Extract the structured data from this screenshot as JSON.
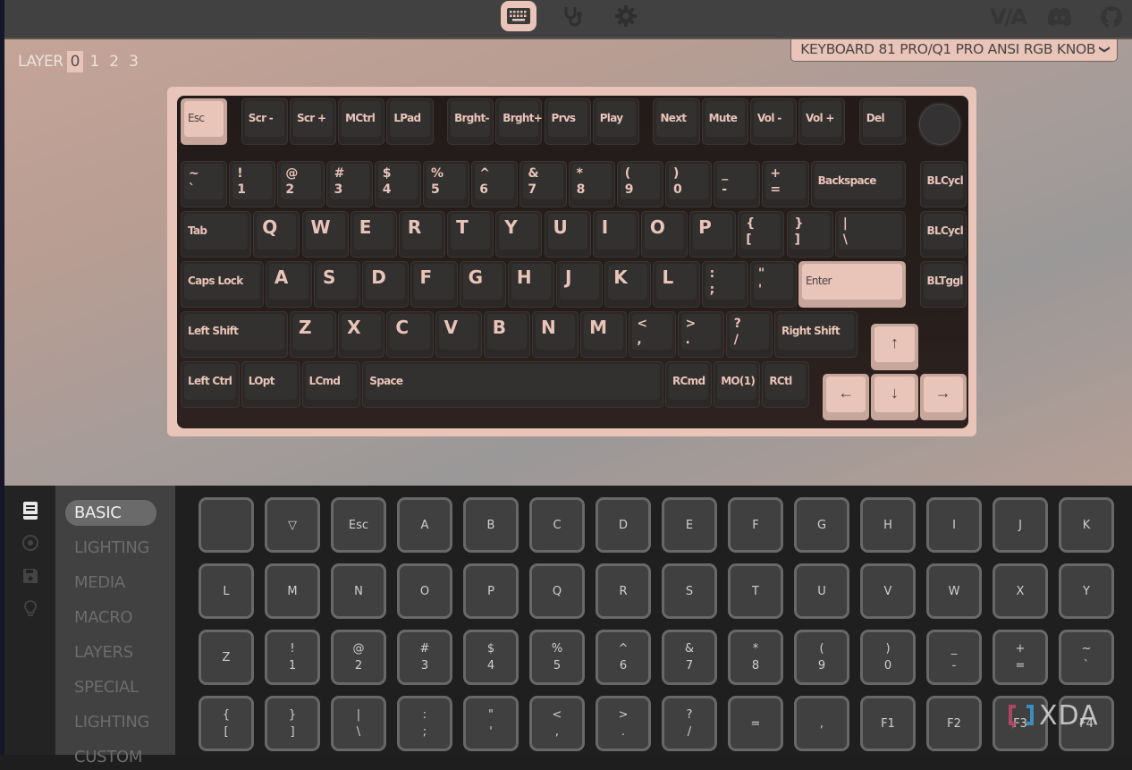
{
  "topbar": {
    "nav": [
      {
        "name": "configure",
        "icon": "keyboard-icon",
        "active": true
      },
      {
        "name": "test",
        "icon": "stethoscope-icon",
        "active": false
      },
      {
        "name": "settings",
        "icon": "gear-icon",
        "active": false
      }
    ],
    "external": [
      {
        "label": "VIA",
        "icon": "via-logo-icon"
      },
      {
        "label": "",
        "icon": "discord-icon"
      },
      {
        "label": "",
        "icon": "github-icon"
      }
    ],
    "via_label": "V/A"
  },
  "layers": {
    "label": "LAYER",
    "items": [
      "0",
      "1",
      "2",
      "3"
    ],
    "active": "0"
  },
  "keyboard_select": {
    "value": "KEYBOARD 81 PRO/Q1 PRO ANSI RGB KNOB",
    "chevron": "❯"
  },
  "keyboard": {
    "rows": [
      [
        {
          "l": "Esc",
          "x": 0,
          "w": 1,
          "accent": true
        },
        {
          "l": "Scr -",
          "x": 1.25,
          "w": 1
        },
        {
          "l": "Scr +",
          "x": 2.25,
          "w": 1
        },
        {
          "l": "MCtrl",
          "x": 3.25,
          "w": 1
        },
        {
          "l": "LPad",
          "x": 4.25,
          "w": 1
        },
        {
          "l": "Brght-",
          "x": 5.5,
          "w": 1
        },
        {
          "l": "Brght+",
          "x": 6.5,
          "w": 1
        },
        {
          "l": "Prvs",
          "x": 7.5,
          "w": 1
        },
        {
          "l": "Play",
          "x": 8.5,
          "w": 1
        },
        {
          "l": "Next",
          "x": 9.75,
          "w": 1
        },
        {
          "l": "Mute",
          "x": 10.75,
          "w": 1
        },
        {
          "l": "Vol -",
          "x": 11.75,
          "w": 1
        },
        {
          "l": "Vol +",
          "x": 12.75,
          "w": 1
        },
        {
          "l": "Del",
          "x": 14,
          "w": 1
        }
      ],
      [
        {
          "top": "~",
          "bot": "`",
          "x": 0,
          "w": 1
        },
        {
          "top": "!",
          "bot": "1",
          "x": 1,
          "w": 1
        },
        {
          "top": "@",
          "bot": "2",
          "x": 2,
          "w": 1
        },
        {
          "top": "#",
          "bot": "3",
          "x": 3,
          "w": 1
        },
        {
          "top": "$",
          "bot": "4",
          "x": 4,
          "w": 1
        },
        {
          "top": "%",
          "bot": "5",
          "x": 5,
          "w": 1
        },
        {
          "top": "^",
          "bot": "6",
          "x": 6,
          "w": 1
        },
        {
          "top": "&",
          "bot": "7",
          "x": 7,
          "w": 1
        },
        {
          "top": "*",
          "bot": "8",
          "x": 8,
          "w": 1
        },
        {
          "top": "(",
          "bot": "9",
          "x": 9,
          "w": 1
        },
        {
          "top": ")",
          "bot": "0",
          "x": 10,
          "w": 1
        },
        {
          "top": "_",
          "bot": "-",
          "x": 11,
          "w": 1
        },
        {
          "top": "+",
          "bot": "=",
          "x": 12,
          "w": 1
        },
        {
          "l": "Backspace",
          "x": 13,
          "w": 2
        },
        {
          "l": "BLCycl",
          "x": 15.25,
          "w": 1
        }
      ],
      [
        {
          "l": "Tab",
          "x": 0,
          "w": 1.5
        },
        {
          "big": "Q",
          "x": 1.5,
          "w": 1
        },
        {
          "big": "W",
          "x": 2.5,
          "w": 1
        },
        {
          "big": "E",
          "x": 3.5,
          "w": 1
        },
        {
          "big": "R",
          "x": 4.5,
          "w": 1
        },
        {
          "big": "T",
          "x": 5.5,
          "w": 1
        },
        {
          "big": "Y",
          "x": 6.5,
          "w": 1
        },
        {
          "big": "U",
          "x": 7.5,
          "w": 1
        },
        {
          "big": "I",
          "x": 8.5,
          "w": 1
        },
        {
          "big": "O",
          "x": 9.5,
          "w": 1
        },
        {
          "big": "P",
          "x": 10.5,
          "w": 1
        },
        {
          "top": "{",
          "bot": "[",
          "x": 11.5,
          "w": 1
        },
        {
          "top": "}",
          "bot": "]",
          "x": 12.5,
          "w": 1
        },
        {
          "top": "|",
          "bot": "\\",
          "x": 13.5,
          "w": 1.5
        },
        {
          "l": "BLCycl",
          "x": 15.25,
          "w": 1
        }
      ],
      [
        {
          "l": "Caps Lock",
          "x": 0,
          "w": 1.75
        },
        {
          "big": "A",
          "x": 1.75,
          "w": 1
        },
        {
          "big": "S",
          "x": 2.75,
          "w": 1
        },
        {
          "big": "D",
          "x": 3.75,
          "w": 1
        },
        {
          "big": "F",
          "x": 4.75,
          "w": 1
        },
        {
          "big": "G",
          "x": 5.75,
          "w": 1
        },
        {
          "big": "H",
          "x": 6.75,
          "w": 1
        },
        {
          "big": "J",
          "x": 7.75,
          "w": 1
        },
        {
          "big": "K",
          "x": 8.75,
          "w": 1
        },
        {
          "big": "L",
          "x": 9.75,
          "w": 1
        },
        {
          "top": ":",
          "bot": ";",
          "x": 10.75,
          "w": 1
        },
        {
          "top": "\"",
          "bot": "'",
          "x": 11.75,
          "w": 1
        },
        {
          "l": "Enter",
          "x": 12.75,
          "w": 2.25,
          "accent": true
        },
        {
          "l": "BLTggl",
          "x": 15.25,
          "w": 1
        }
      ],
      [
        {
          "l": "Left Shift",
          "x": 0,
          "w": 2.25
        },
        {
          "big": "Z",
          "x": 2.25,
          "w": 1
        },
        {
          "big": "X",
          "x": 3.25,
          "w": 1
        },
        {
          "big": "C",
          "x": 4.25,
          "w": 1
        },
        {
          "big": "V",
          "x": 5.25,
          "w": 1
        },
        {
          "big": "B",
          "x": 6.25,
          "w": 1
        },
        {
          "big": "N",
          "x": 7.25,
          "w": 1
        },
        {
          "big": "M",
          "x": 8.25,
          "w": 1
        },
        {
          "top": "<",
          "bot": ",",
          "x": 9.25,
          "w": 1
        },
        {
          "top": ">",
          "bot": ".",
          "x": 10.25,
          "w": 1
        },
        {
          "top": "?",
          "bot": "/",
          "x": 11.25,
          "w": 1
        },
        {
          "l": "Right Shift",
          "x": 12.25,
          "w": 1.75
        },
        {
          "arrow": "↑",
          "x": 14.25,
          "w": 1,
          "accent": true,
          "dy": 0.25
        }
      ],
      [
        {
          "l": "Left Ctrl",
          "x": 0,
          "w": 1.25
        },
        {
          "l": "LOpt",
          "x": 1.25,
          "w": 1.25
        },
        {
          "l": "LCmd",
          "x": 2.5,
          "w": 1.25
        },
        {
          "l": "Space",
          "x": 3.75,
          "w": 6.25
        },
        {
          "l": "RCmd",
          "x": 10,
          "w": 1
        },
        {
          "l": "MO(1)",
          "x": 11,
          "w": 1
        },
        {
          "l": "RCtl",
          "x": 12,
          "w": 1
        },
        {
          "arrow": "←",
          "x": 13.25,
          "w": 1,
          "accent": true,
          "dy": 0.25
        },
        {
          "arrow": "↓",
          "x": 14.25,
          "w": 1,
          "accent": true,
          "dy": 0.25
        },
        {
          "arrow": "→",
          "x": 15.25,
          "w": 1,
          "accent": true,
          "dy": 0.25
        }
      ]
    ]
  },
  "sidebar_icons": [
    {
      "name": "keycode-book-icon",
      "active": true
    },
    {
      "name": "target-icon",
      "active": false
    },
    {
      "name": "save-icon",
      "active": false
    },
    {
      "name": "lightbulb-icon",
      "active": false
    }
  ],
  "menu": {
    "items": [
      "BASIC",
      "LIGHTING",
      "MEDIA",
      "MACRO",
      "LAYERS",
      "SPECIAL",
      "LIGHTING",
      "CUSTOM"
    ],
    "active": "BASIC"
  },
  "keycodes": [
    [
      [
        ""
      ],
      [
        "▽"
      ],
      [
        "Esc"
      ],
      [
        "A"
      ],
      [
        "B"
      ],
      [
        "C"
      ],
      [
        "D"
      ],
      [
        "E"
      ],
      [
        "F"
      ],
      [
        "G"
      ],
      [
        "H"
      ],
      [
        "I"
      ],
      [
        "J"
      ],
      [
        "K"
      ]
    ],
    [
      [
        "L"
      ],
      [
        "M"
      ],
      [
        "N"
      ],
      [
        "O"
      ],
      [
        "P"
      ],
      [
        "Q"
      ],
      [
        "R"
      ],
      [
        "S"
      ],
      [
        "T"
      ],
      [
        "U"
      ],
      [
        "V"
      ],
      [
        "W"
      ],
      [
        "X"
      ],
      [
        "Y"
      ]
    ],
    [
      [
        "Z"
      ],
      [
        "!",
        "1"
      ],
      [
        "@",
        "2"
      ],
      [
        "#",
        "3"
      ],
      [
        "$",
        "4"
      ],
      [
        "%",
        "5"
      ],
      [
        "^",
        "6"
      ],
      [
        "&",
        "7"
      ],
      [
        "*",
        "8"
      ],
      [
        "(",
        "9"
      ],
      [
        ")",
        "0"
      ],
      [
        "_",
        "-"
      ],
      [
        "+",
        "="
      ],
      [
        "~",
        "`"
      ]
    ],
    [
      [
        "{",
        "["
      ],
      [
        "}",
        "]"
      ],
      [
        "|",
        "\\"
      ],
      [
        ":",
        ";"
      ],
      [
        "\"",
        "'"
      ],
      [
        "<",
        ","
      ],
      [
        ">",
        "."
      ],
      [
        "?",
        "/"
      ],
      [
        "="
      ],
      [
        ","
      ],
      [
        "F1"
      ],
      [
        "F2"
      ],
      [
        "F3"
      ],
      [
        "F4"
      ]
    ]
  ],
  "watermark": {
    "text": "XDA"
  },
  "colors": {
    "accent": "#e9c4b8",
    "topbar": "#414141",
    "panel": "#1f1f1f",
    "menu": "#414141",
    "keycap": "#333030",
    "legend": "#e9c4b8"
  }
}
